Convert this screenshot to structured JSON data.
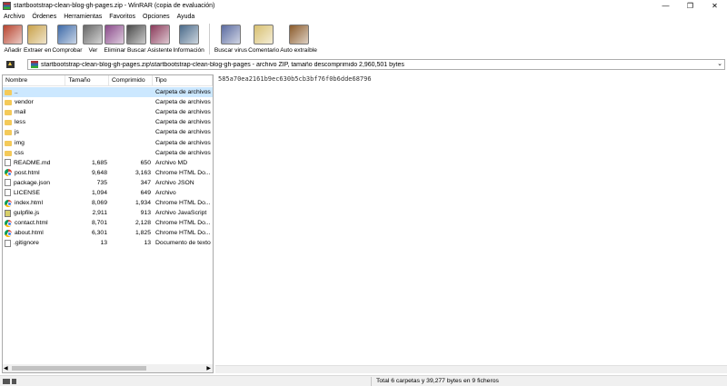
{
  "window": {
    "title": "startbootstrap-clean-blog-gh-pages.zip - WinRAR (copia de evaluación)",
    "minimize": "—",
    "maximize": "❐",
    "close": "✕"
  },
  "menu": [
    "Archivo",
    "Órdenes",
    "Herramientas",
    "Favoritos",
    "Opciones",
    "Ayuda"
  ],
  "toolbar": {
    "buttons": [
      {
        "label": "Añadir",
        "icon": "add-archive-icon",
        "color": "#b8442f"
      },
      {
        "label": "Extraer en",
        "icon": "extract-to-icon",
        "color": "#c9a24a"
      },
      {
        "label": "Comprobar",
        "icon": "test-icon",
        "color": "#3e6aa8"
      },
      {
        "label": "Ver",
        "icon": "view-glasses-icon",
        "color": "#666666"
      },
      {
        "label": "Eliminar",
        "icon": "delete-icon",
        "color": "#8a4a8a"
      },
      {
        "label": "Buscar",
        "icon": "find-binoculars-icon",
        "color": "#4a4a4a"
      },
      {
        "label": "Asistente",
        "icon": "wizard-icon",
        "color": "#8a3a5a"
      },
      {
        "label": "Información",
        "icon": "info-icon",
        "color": "#4a6a8a"
      }
    ],
    "buttons2": [
      {
        "label": "Buscar virus",
        "icon": "virus-scan-icon",
        "color": "#5a6aa0"
      },
      {
        "label": "Comentario",
        "icon": "comment-icon",
        "color": "#d8c070"
      },
      {
        "label": "Auto extraíble",
        "icon": "sfx-icon",
        "color": "#8a5a2a"
      }
    ]
  },
  "address": {
    "path": "startbootstrap-clean-blog-gh-pages.zip\\startbootstrap-clean-blog-gh-pages - archivo ZIP, tamaño descomprimido 2,960,501 bytes"
  },
  "columns": {
    "name": "Nombre",
    "size": "Tamaño",
    "packed": "Comprimido",
    "type": "Tipo"
  },
  "files": [
    {
      "name": "..",
      "size": "",
      "packed": "",
      "type": "Carpeta de archivos",
      "icon": "folder-up"
    },
    {
      "name": "vendor",
      "size": "",
      "packed": "",
      "type": "Carpeta de archivos",
      "icon": "folder"
    },
    {
      "name": "mail",
      "size": "",
      "packed": "",
      "type": "Carpeta de archivos",
      "icon": "folder"
    },
    {
      "name": "less",
      "size": "",
      "packed": "",
      "type": "Carpeta de archivos",
      "icon": "folder"
    },
    {
      "name": "js",
      "size": "",
      "packed": "",
      "type": "Carpeta de archivos",
      "icon": "folder"
    },
    {
      "name": "img",
      "size": "",
      "packed": "",
      "type": "Carpeta de archivos",
      "icon": "folder"
    },
    {
      "name": "css",
      "size": "",
      "packed": "",
      "type": "Carpeta de archivos",
      "icon": "folder"
    },
    {
      "name": "README.md",
      "size": "1,685",
      "packed": "650",
      "type": "Archivo MD",
      "icon": "doc"
    },
    {
      "name": "post.html",
      "size": "9,648",
      "packed": "3,163",
      "type": "Chrome HTML Do...",
      "icon": "chrome"
    },
    {
      "name": "package.json",
      "size": "735",
      "packed": "347",
      "type": "Archivo JSON",
      "icon": "doc"
    },
    {
      "name": "LICENSE",
      "size": "1,094",
      "packed": "649",
      "type": "Archivo",
      "icon": "doc"
    },
    {
      "name": "index.html",
      "size": "8,069",
      "packed": "1,934",
      "type": "Chrome HTML Do...",
      "icon": "chrome"
    },
    {
      "name": "gulpfile.js",
      "size": "2,911",
      "packed": "913",
      "type": "Archivo JavaScript",
      "icon": "js"
    },
    {
      "name": "contact.html",
      "size": "8,701",
      "packed": "2,128",
      "type": "Chrome HTML Do...",
      "icon": "chrome"
    },
    {
      "name": "about.html",
      "size": "6,301",
      "packed": "1,825",
      "type": "Chrome HTML Do...",
      "icon": "chrome"
    },
    {
      "name": ".gitignore",
      "size": "13",
      "packed": "13",
      "type": "Documento de texto",
      "icon": "doc"
    }
  ],
  "comment": "585a70ea2161b9ec630b5cb3bf76f0b6dde68796",
  "status": {
    "total": "Total 6 carpetas y 39,277 bytes en 9 ficheros"
  }
}
